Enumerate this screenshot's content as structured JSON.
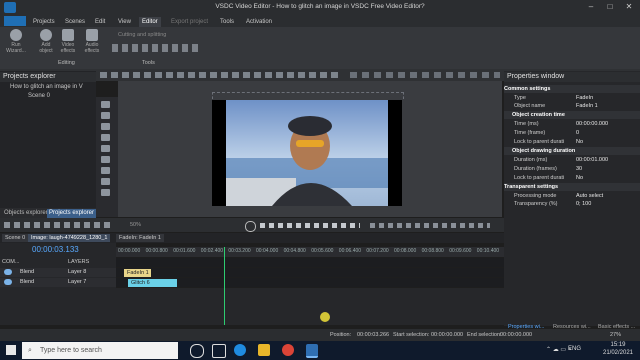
{
  "window": {
    "title": "VSDC Video Editor - How to glitch an image in VSDC Free Video Editor?"
  },
  "menu": {
    "items": [
      "Projects",
      "Scenes",
      "Edit",
      "View",
      "Editor",
      "Export project",
      "Tools",
      "Activation"
    ],
    "active": "Editor"
  },
  "ribbon": {
    "run_wizard": "Run Wizard...",
    "add_object": "Add object",
    "video_effects": "Video effects",
    "audio_effects": "Audio effects",
    "cutting": "Cutting and splitting",
    "group_editing": "Editing",
    "group_tools": "Tools"
  },
  "projects_explorer": {
    "title": "Projects explorer",
    "items": [
      "How to glitch an image in V",
      "Scene 0"
    ],
    "tabs": [
      "Objects explorer",
      "Projects explorer"
    ]
  },
  "properties": {
    "title": "Properties window",
    "sections": {
      "common": "Common settings",
      "creation": "Object creation time",
      "drawing": "Object drawing duration",
      "transparent": "Transparent settings"
    },
    "rows": {
      "type_k": "Type",
      "type_v": "FadeIn",
      "name_k": "Object name",
      "name_v": "FadeIn 1",
      "time_ms_k": "Time (ms)",
      "time_ms_v": "00:00:00.000",
      "time_frame_k": "Time (frame)",
      "time_frame_v": "0",
      "lock_k": "Lock to parent durati",
      "lock_v": "No",
      "dur_ms_k": "Duration (ms)",
      "dur_ms_v": "00:00:01.000",
      "dur_frames_k": "Duration (frames)",
      "dur_frames_v": "30",
      "lock2_k": "Lock to parent durati",
      "lock2_v": "No",
      "mode_k": "Processing mode",
      "mode_v": "Auto select",
      "transp_k": "Transparency (%)",
      "transp_v": "0; 100"
    },
    "tabs": [
      "Properties wi...",
      "Resources wi...",
      "Basic effects ..."
    ]
  },
  "timeline": {
    "tabs": [
      "Scene 0",
      "Image: laugh-4749228_1280_1",
      "FadeIn: FadeIn 1"
    ],
    "time": "00:00:03.133",
    "com_label": "COM...",
    "layers_label": "LAYERS",
    "zoom_label": "50%",
    "ticks": [
      "00:00.000",
      "00:00.400",
      "00:00.800",
      "00:01.200",
      "00:01.600",
      "00:02.000",
      "00:02.400",
      "00:02.800",
      "00:03.200",
      "00:03.600",
      "00:04.000",
      "00:04.400",
      "00:04.800",
      "00:05.200",
      "00:05.600",
      "00:06.000",
      "00:06.400",
      "00:06.800",
      "00:07.200",
      "00:07.600",
      "00:08.000",
      "00:08.400",
      "00:08.800",
      "00:09.200",
      "00:09.600",
      "00:10.000",
      "00:10.400"
    ],
    "layers": [
      {
        "blend": "Blend",
        "name": "Layer 8",
        "clip": "FadeIn 1"
      },
      {
        "blend": "Blend",
        "name": "Layer 7",
        "clip": "Glitch 6"
      }
    ]
  },
  "status": {
    "position_label": "Position:",
    "position": "00:00:03.266",
    "start_label": "Start selection:",
    "start": "00:00:00.000",
    "end_label": "End selection:",
    "end": "00:00:00.000",
    "zoom": "27%"
  },
  "taskbar": {
    "search_placeholder": "Type here to search",
    "lang": "ENG",
    "time": "15:19",
    "date": "21/02/2021"
  },
  "colors": {
    "accent": "#58a9ff",
    "clip_fadein": "#e8d58a",
    "clip_glitch": "#6ad1e8",
    "playhead": "#2ecc71"
  }
}
